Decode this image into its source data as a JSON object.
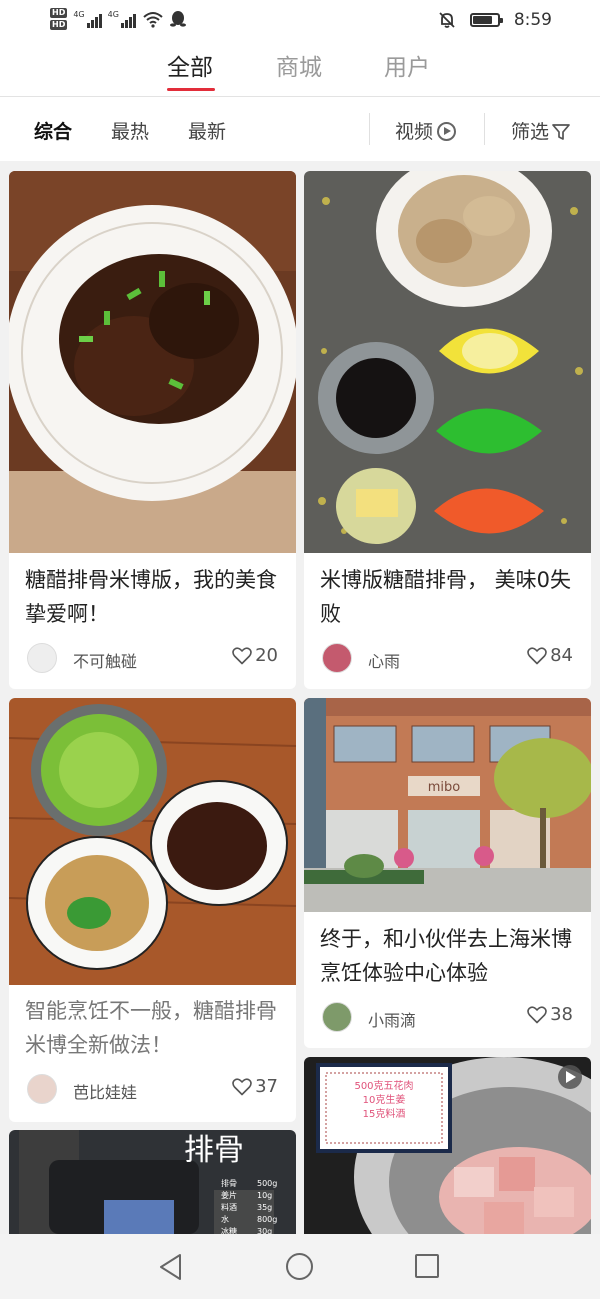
{
  "status_bar": {
    "hd_labels": [
      "HD",
      "HD"
    ],
    "signal_labels": [
      "4G",
      "4G"
    ],
    "time": "8:59",
    "battery_level": 0.75
  },
  "top_tabs": [
    {
      "label": "全部",
      "active": true
    },
    {
      "label": "商城",
      "active": false
    },
    {
      "label": "用户",
      "active": false
    }
  ],
  "filters": {
    "sort": [
      {
        "label": "综合",
        "active": true
      },
      {
        "label": "最热",
        "active": false
      },
      {
        "label": "最新",
        "active": false
      }
    ],
    "video_label": "视频",
    "filter_label": "筛选"
  },
  "feed": [
    {
      "title": "糖醋排骨米博版，我的美食挚爱啊！",
      "author": "不可触碰",
      "likes": "20"
    },
    {
      "title": "米博版糖醋排骨， 美味0失败",
      "author": "心雨",
      "likes": "84"
    },
    {
      "title": "智能烹饪不一般，糖醋排骨米博全新做法！",
      "author": "芭比娃娃",
      "likes": "37"
    },
    {
      "title": "终于，和小伙伴去上海米博烹饪体验中心体验",
      "author": "小雨滴",
      "likes": "38"
    },
    {
      "overlay_title": "排骨",
      "recipe_rows": [
        [
          "排骨",
          "500g"
        ],
        [
          "姜片",
          "10g"
        ],
        [
          "料酒",
          "35g"
        ],
        [
          "水",
          "800g"
        ],
        [
          "冰糖",
          "30g"
        ]
      ]
    },
    {
      "note_lines": [
        "500克五花肉",
        "10克生姜",
        "15克料酒"
      ]
    }
  ],
  "storefront_sign": "mibo",
  "colors": {
    "accent": "#e22d3a",
    "background": "#f1f1f1"
  }
}
